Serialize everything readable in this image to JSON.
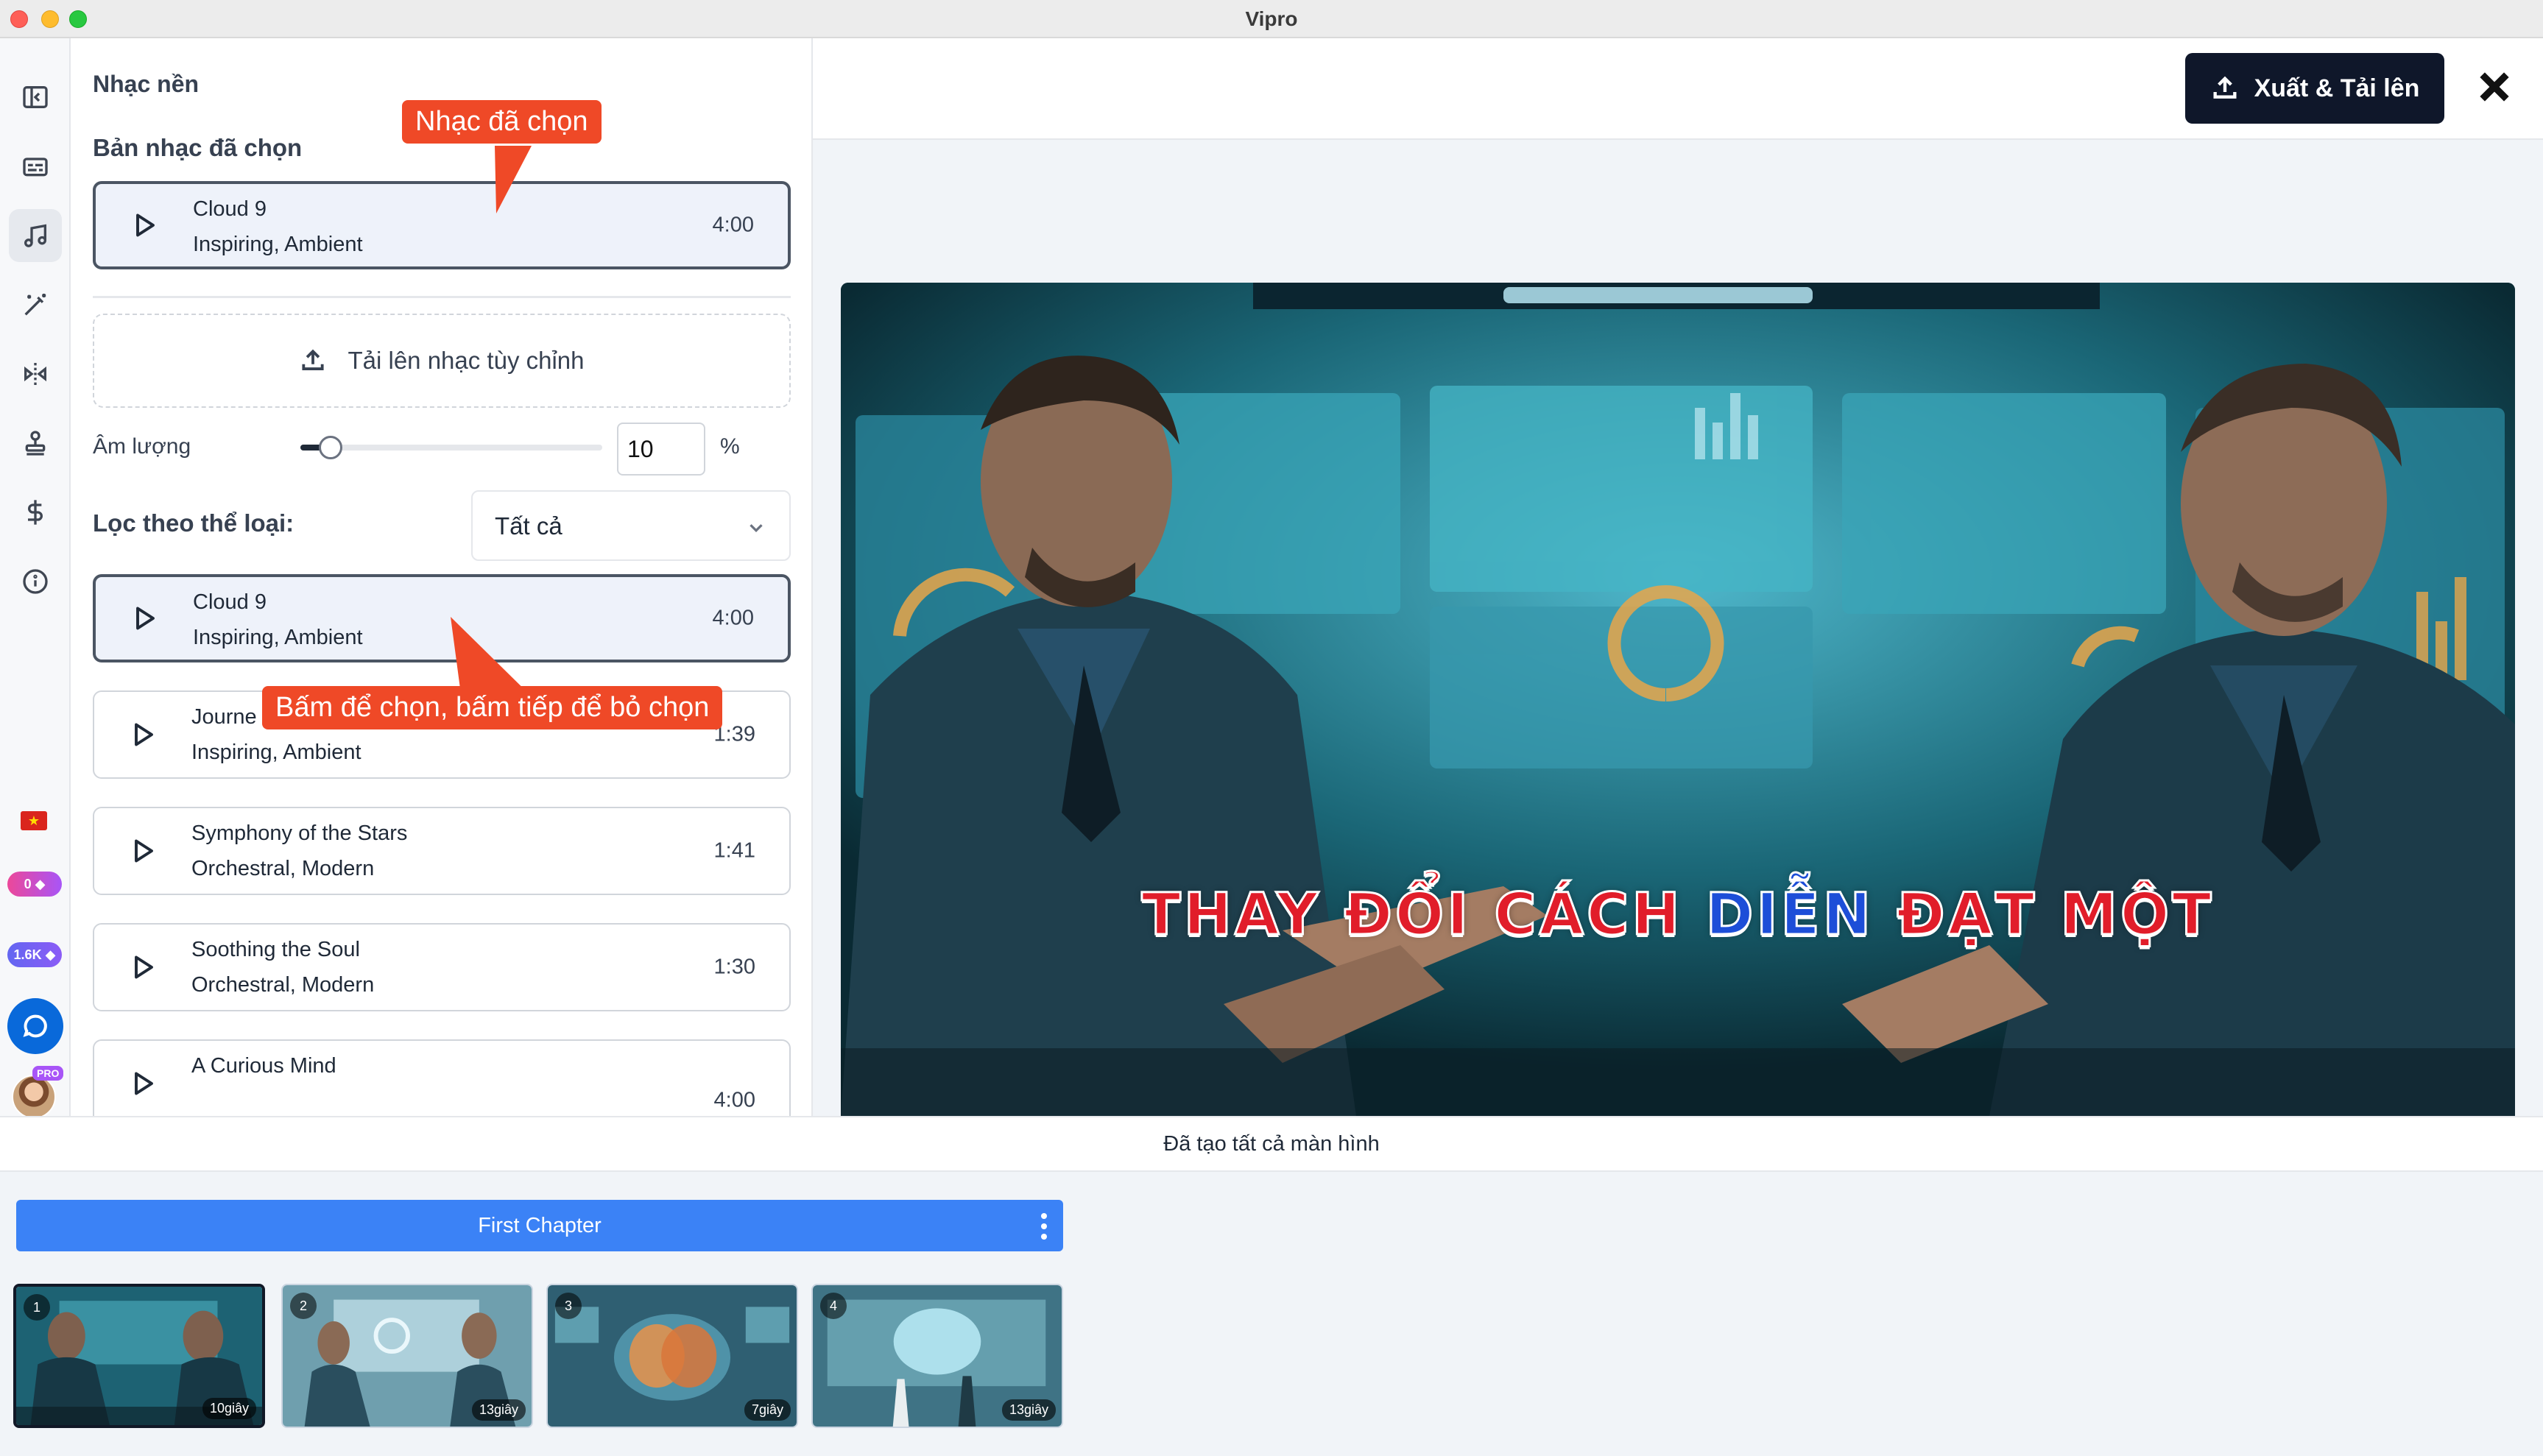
{
  "app": {
    "title": "Vipro"
  },
  "panel": {
    "title": "Nhạc nền",
    "selected_heading": "Bản nhạc đã chọn",
    "selected_track": {
      "name": "Cloud 9",
      "tags": "Inspiring, Ambient",
      "duration": "4:00"
    },
    "upload_label": "Tải lên nhạc tùy chỉnh",
    "volume": {
      "label": "Âm lượng",
      "value": "10",
      "unit": "%",
      "fraction": 0.1
    },
    "filter": {
      "label": "Lọc theo thể loại:",
      "value": "Tất cả"
    },
    "tracks": [
      {
        "name": "Cloud 9",
        "tags": "Inspiring, Ambient",
        "duration": "4:00",
        "selected": true
      },
      {
        "name": "Journe",
        "tags": "Inspiring, Ambient",
        "duration": "1:39",
        "selected": false
      },
      {
        "name": "Symphony of the Stars",
        "tags": "Orchestral, Modern",
        "duration": "1:41",
        "selected": false
      },
      {
        "name": "Soothing the Soul",
        "tags": "Orchestral, Modern",
        "duration": "1:30",
        "selected": false
      },
      {
        "name": "A Curious Mind",
        "tags": "",
        "duration": "4:00",
        "selected": false
      }
    ]
  },
  "callouts": {
    "selected_music": "Nhạc đã chọn",
    "click_hint": "Bấm để chọn, bấm tiếp để bỏ chọn"
  },
  "rail": {
    "icons": [
      "panel-toggle-icon",
      "subtitles-icon",
      "music-icon",
      "magic-wand-icon",
      "transition-icon",
      "stamp-icon",
      "dollar-icon",
      "info-icon"
    ],
    "active_index": 2,
    "credits_a": "0",
    "credits_b": "1.6K",
    "pro_badge": "PRO"
  },
  "header": {
    "export_label": "Xuất & Tải lên"
  },
  "video": {
    "caption_words": [
      "THAY",
      "ĐỔI",
      "CÁCH",
      "DIỄN",
      "ĐẠT",
      "MỘT"
    ],
    "highlight_index": 3
  },
  "status": {
    "text": "Đã tạo tất cả màn hình"
  },
  "timeline": {
    "chapter": "First Chapter",
    "scenes": [
      {
        "number": "1",
        "duration": "10giây",
        "active": true
      },
      {
        "number": "2",
        "duration": "13giây",
        "active": false
      },
      {
        "number": "3",
        "duration": "7giây",
        "active": false
      },
      {
        "number": "4",
        "duration": "13giây",
        "active": false
      }
    ]
  },
  "colors": {
    "accent": "#ef4927",
    "export_bg": "#0f172a",
    "chapter_bg": "#3b82f6"
  }
}
